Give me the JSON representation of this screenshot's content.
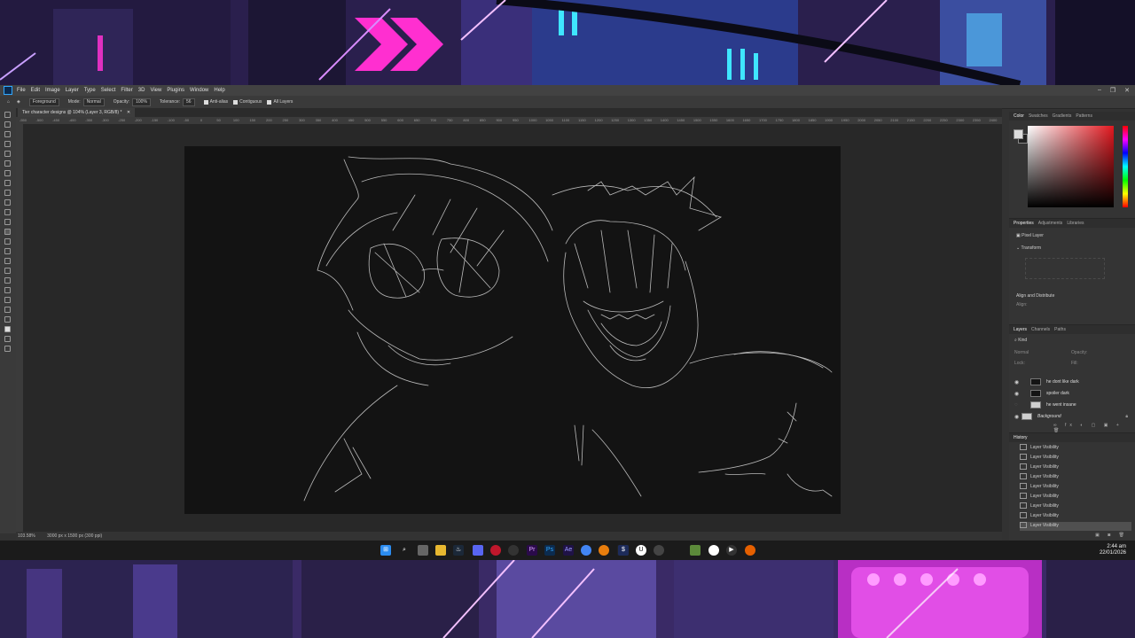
{
  "app": {
    "menu": [
      "File",
      "Edit",
      "Image",
      "Layer",
      "Type",
      "Select",
      "Filter",
      "3D",
      "View",
      "Plugins",
      "Window",
      "Help"
    ]
  },
  "options_bar": {
    "fill_source": "Foreground",
    "mode_label": "Mode:",
    "mode_value": "Normal",
    "opacity_label": "Opacity:",
    "opacity_value": "100%",
    "tolerance_label": "Tolerance:",
    "tolerance_value": "56",
    "anti_alias": "Anti-alias",
    "contiguous": "Contiguous",
    "all_layers": "All Layers"
  },
  "document": {
    "tab_title": "Tier character designs @ 104% (Layer 3, RGB/8) *",
    "zoom": "103.58%",
    "size_info": "3000 px x 1500 px (300 ppi)"
  },
  "ruler_labels": [
    "-550",
    "-500",
    "-450",
    "-400",
    "-350",
    "-300",
    "-250",
    "-200",
    "-150",
    "-100",
    "-50",
    "0",
    "50",
    "100",
    "150",
    "200",
    "250",
    "300",
    "350",
    "400",
    "450",
    "500",
    "550",
    "600",
    "650",
    "700",
    "750",
    "800",
    "850",
    "900",
    "950",
    "1000",
    "1050",
    "1100",
    "1150",
    "1200",
    "1250",
    "1300",
    "1350",
    "1400",
    "1450",
    "1500",
    "1550",
    "1600",
    "1650",
    "1700",
    "1750",
    "1800",
    "1850",
    "1900",
    "1950",
    "2000",
    "2050",
    "2100",
    "2150",
    "2200",
    "2250",
    "2300",
    "2350",
    "2400"
  ],
  "color_panel": {
    "tabs": [
      "Color",
      "Swatches",
      "Gradients",
      "Patterns"
    ],
    "fg": "#dddddd",
    "bg": "#222222",
    "hue_color": "#e2181f"
  },
  "properties_panel": {
    "tabs": [
      "Properties",
      "Adjustments",
      "Libraries"
    ],
    "type": "Pixel Layer",
    "transform": "Transform",
    "align": "Align and Distribute",
    "align_sub": "Align:"
  },
  "layers_panel": {
    "tabs": [
      "Layers",
      "Channels",
      "Paths"
    ],
    "filter": "Kind",
    "blend": "Normal",
    "opacity_label": "Opacity:",
    "lock_label": "Lock:",
    "fill_label": "Fill:",
    "layers": [
      {
        "name": "he dont like dark",
        "visible": true,
        "thumb": "dark"
      },
      {
        "name": "spoiler dark",
        "visible": true,
        "thumb": "dark"
      },
      {
        "name": "he went insane",
        "visible": false,
        "thumb": "light"
      },
      {
        "name": "Background",
        "visible": true,
        "thumb": "light"
      }
    ]
  },
  "history_panel": {
    "title": "History",
    "items": [
      "Layer Visibility",
      "Layer Visibility",
      "Layer Visibility",
      "Layer Visibility",
      "Layer Visibility",
      "Layer Visibility",
      "Layer Visibility",
      "Layer Visibility",
      "Layer Visibility"
    ]
  },
  "taskbar": {
    "time": "2:44 am",
    "date": "22/01/2026",
    "icons": [
      "start",
      "search",
      "taskview",
      "explorer",
      "steam",
      "discord",
      "opera",
      "firefox",
      "premiere",
      "photoshop",
      "after-effects",
      "chrome",
      "blender",
      "unreal",
      "epic",
      "obs",
      "minecraft",
      "osu",
      "media",
      "app"
    ]
  }
}
